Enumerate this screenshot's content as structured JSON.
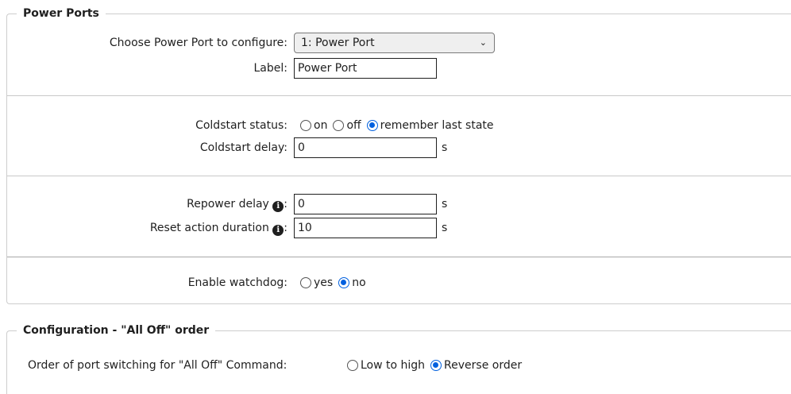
{
  "power_ports": {
    "legend": "Power Ports",
    "choose_port_label": "Choose Power Port to configure:",
    "port_select_value": "1: Power Port",
    "label_label": "Label:",
    "label_value": "Power Port",
    "coldstart_status_label": "Coldstart status:",
    "coldstart_options": [
      "on",
      "off",
      "remember last state"
    ],
    "coldstart_selected": "remember last state",
    "coldstart_delay_label": "Coldstart delay:",
    "coldstart_delay_value": "0",
    "repower_delay_label": "Repower delay",
    "repower_delay_value": "0",
    "reset_duration_label": "Reset action duration",
    "reset_duration_value": "10",
    "watchdog_label": "Enable watchdog:",
    "watchdog_options": [
      "yes",
      "no"
    ],
    "watchdog_selected": "no",
    "unit": "s",
    "colon": ":"
  },
  "all_off": {
    "legend": "Configuration - \"All Off\" order",
    "order_label": "Order of port switching for \"All Off\" Command:",
    "order_options": [
      "Low to high",
      "Reverse order"
    ],
    "order_selected": "Reverse order"
  },
  "colors": {
    "radio_selected": "#0060df",
    "border": "#cdcdcd"
  },
  "icons": {
    "info": "info-circle-icon",
    "dropdown": "chevron-down-icon"
  }
}
